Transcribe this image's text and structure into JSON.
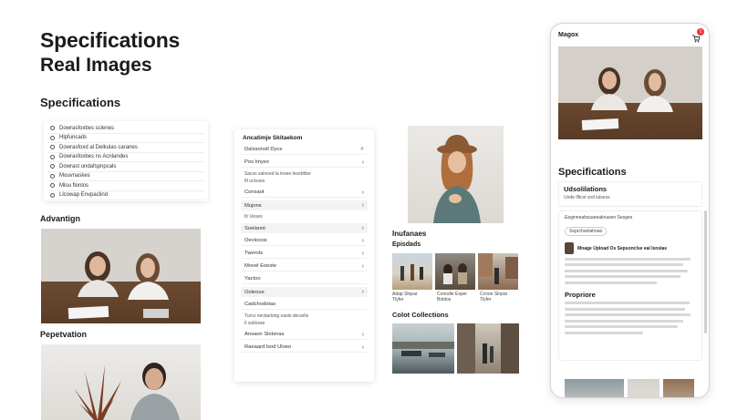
{
  "hero": {
    "title": "Specifications",
    "subtitle": "Real Images"
  },
  "specs": {
    "title": "Specifications",
    "items": [
      "Dowrasfoxbes sclenes",
      "Hlpfuncads",
      "Dowrasfoxd al Delkulas caranes",
      "Dowrasfoxbes ns Acnlandes",
      "Dowrast undafspnpcals",
      "Mouvnaskes",
      "Mlou flonlos",
      "Llcowap Envpaclind"
    ]
  },
  "advantage": {
    "title": "Advantign"
  },
  "pepetation": {
    "title": "Pepetvation"
  },
  "list_card": {
    "title": "Ancatimje Skitaekom",
    "rows": [
      {
        "label": "Dalssonstl Dyce",
        "icon": "search-icon",
        "style": "w"
      },
      {
        "label": "Pos Imyes",
        "icon": "chevron-right-icon",
        "style": "w"
      },
      {
        "note": "Sacss salnoed la lesee lesebbbe"
      },
      {
        "note": "Ilf ucloses"
      },
      {
        "label": "Consaot",
        "icon": "chevron-right-icon",
        "style": "w"
      },
      {
        "label": "Mujons",
        "icon": "chevron-right-icon",
        "style": "g"
      },
      {
        "note": "Ilr Ueses"
      },
      {
        "label": "Soelanot",
        "icon": "chevron-right-icon",
        "style": "g"
      },
      {
        "label": "Oectooos",
        "icon": "chevron-right-icon",
        "style": "w"
      },
      {
        "label": "Twerols",
        "icon": "chevron-right-icon",
        "style": "w"
      },
      {
        "label": "Movel Eoeste",
        "icon": "chevron-right-icon",
        "style": "w"
      },
      {
        "label": "Yactoo",
        "icon": "",
        "style": "w"
      },
      {
        "label": "Ooleous",
        "icon": "chevron-right-icon",
        "style": "g"
      },
      {
        "label": "Cadchodotas",
        "icon": "",
        "style": "w"
      },
      {
        "note": "Turcs nectaelong oasle decarlis"
      },
      {
        "note": "Il sutlosse"
      },
      {
        "label": "Ansaon Slotsnas",
        "icon": "chevron-right-icon",
        "style": "w"
      },
      {
        "label": "Raeaard lsod Uloeo",
        "icon": "chevron-right-icon",
        "style": "w"
      }
    ]
  },
  "influences": {
    "title": "Inufanaes",
    "subtitle": "Episdads",
    "thumbs": [
      {
        "caption1": "Adap Slopar",
        "caption2": "Tlyfer"
      },
      {
        "caption1": "Conndie Exper",
        "caption2": "Boldos"
      },
      {
        "caption1": "Ccnoe Slopar",
        "caption2": "Tlyfer"
      }
    ]
  },
  "collections": {
    "title": "Colot Collections"
  },
  "phone": {
    "brand": "Magox",
    "cart_count": "1",
    "spec_title": "Specifications",
    "box_title": "Udsolilations",
    "box_sub": "Unde lflicst snd lulsess",
    "panel_label": "Eeginneabssaeeaknasen Sesges",
    "pill": "Soprchanlahoao",
    "product_title": "Mnage Upload Os Sepsonclse eal Isnslas",
    "prop_title": "Propriore"
  },
  "colors": {
    "accent": "#e33333",
    "text": "#1b1b1b",
    "card_bg": "#ffffff"
  }
}
